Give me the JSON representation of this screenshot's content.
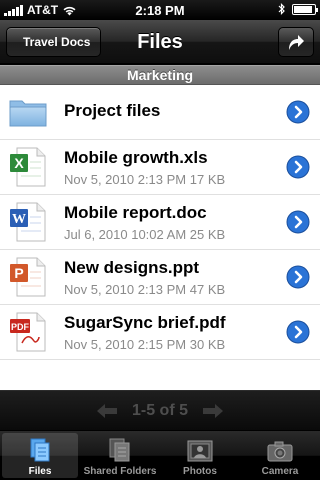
{
  "status_bar": {
    "carrier": "AT&T",
    "time": "2:18 PM",
    "battery_level": 0.9
  },
  "nav": {
    "back_label": "Travel Docs",
    "title": "Files",
    "share_icon": "share-arrow-icon"
  },
  "section": {
    "title": "Marketing"
  },
  "items": [
    {
      "name": "Project files",
      "meta": "",
      "icon": "folder-icon"
    },
    {
      "name": "Mobile growth.xls",
      "meta": "Nov 5, 2010 2:13 PM 17 KB",
      "icon": "excel-file-icon"
    },
    {
      "name": "Mobile report.doc",
      "meta": "Jul 6, 2010 10:02 AM 25 KB",
      "icon": "word-file-icon"
    },
    {
      "name": "New designs.ppt",
      "meta": "Nov 5, 2010 2:13 PM 47 KB",
      "icon": "powerpoint-file-icon"
    },
    {
      "name": "SugarSync brief.pdf",
      "meta": "Nov 5, 2010 2:15 PM 30 KB",
      "icon": "pdf-file-icon"
    }
  ],
  "pager": {
    "label": "1-5 of 5"
  },
  "tabs": [
    {
      "label": "Files",
      "active": true
    },
    {
      "label": "Shared Folders",
      "active": false
    },
    {
      "label": "Photos",
      "active": false
    },
    {
      "label": "Camera",
      "active": false
    }
  ],
  "colors": {
    "disclosure_blue": "#2a73d6",
    "excel_green": "#2d8a3a",
    "word_blue": "#2b5fb5",
    "ppt_orange": "#d2582a",
    "pdf_red": "#c8281e"
  }
}
